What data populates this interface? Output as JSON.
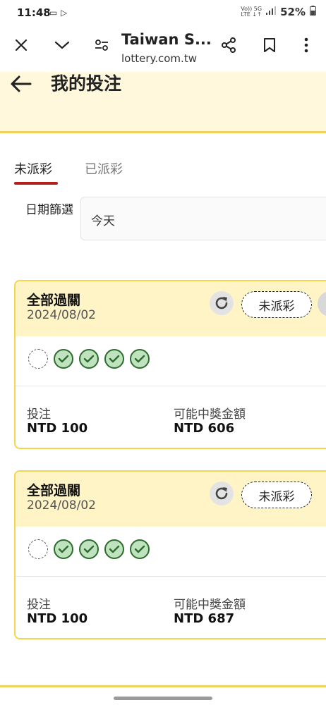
{
  "status_bar": {
    "time": "11:48",
    "net_top": "Vo)) 5G",
    "net_bottom": "LTE ↓↑",
    "battery": "52%"
  },
  "browser": {
    "site_title": "Taiwan S...",
    "url": "lottery.com.tw",
    "icons": [
      "close-icon",
      "chevron-down-icon",
      "site-settings-icon",
      "share-icon",
      "bookmark-icon",
      "more-vert-icon"
    ]
  },
  "page": {
    "title": "我的投注"
  },
  "tabs": [
    {
      "label": "未派彩",
      "active": true
    },
    {
      "label": "已派彩",
      "active": false
    }
  ],
  "filter": {
    "label": "日期篩選",
    "value": "今天"
  },
  "bets": [
    {
      "type": "全部過關",
      "date": "2024/08/02",
      "status": "未派彩",
      "legs": [
        "pending",
        "won",
        "won",
        "won",
        "won"
      ],
      "stake_label": "投注",
      "stake": "NTD 100",
      "payout_label": "可能中獎金額",
      "payout": "NTD 606"
    },
    {
      "type": "全部過關",
      "date": "2024/08/02",
      "status": "未派彩",
      "legs": [
        "pending",
        "won",
        "won",
        "won",
        "won"
      ],
      "stake_label": "投注",
      "stake": "NTD 100",
      "payout_label": "可能中獎金額",
      "payout": "NTD 687"
    }
  ],
  "colors": {
    "accent_red": "#b0211c",
    "card_border": "#f2d64d",
    "card_header_bg": "#fff4c6",
    "won_green": "#2e6b2e"
  }
}
